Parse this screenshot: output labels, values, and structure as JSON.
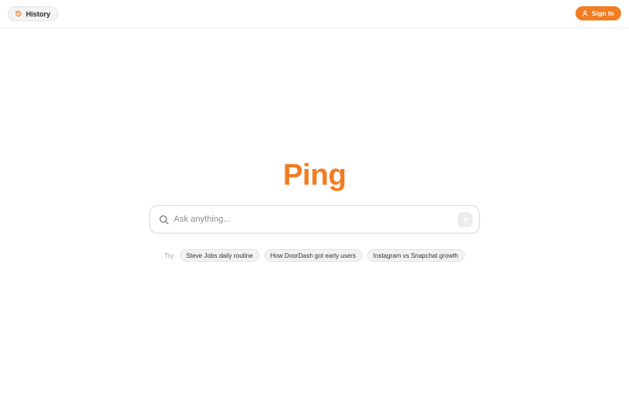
{
  "header": {
    "history_label": "History",
    "signin_label": "Sign In"
  },
  "brand": {
    "name": "Ping",
    "accent_color": "#f27c22"
  },
  "search": {
    "placeholder": "Ask anything...",
    "value": ""
  },
  "suggestions": {
    "prefix": "Try:",
    "items": [
      "Steve Jobs daily routine",
      "How DoorDash got early users",
      "Instagram vs Snapchat growth"
    ]
  },
  "icons": {
    "history": "history-icon",
    "user": "user-icon",
    "search": "search-icon",
    "submit": "arrow-up-icon"
  }
}
